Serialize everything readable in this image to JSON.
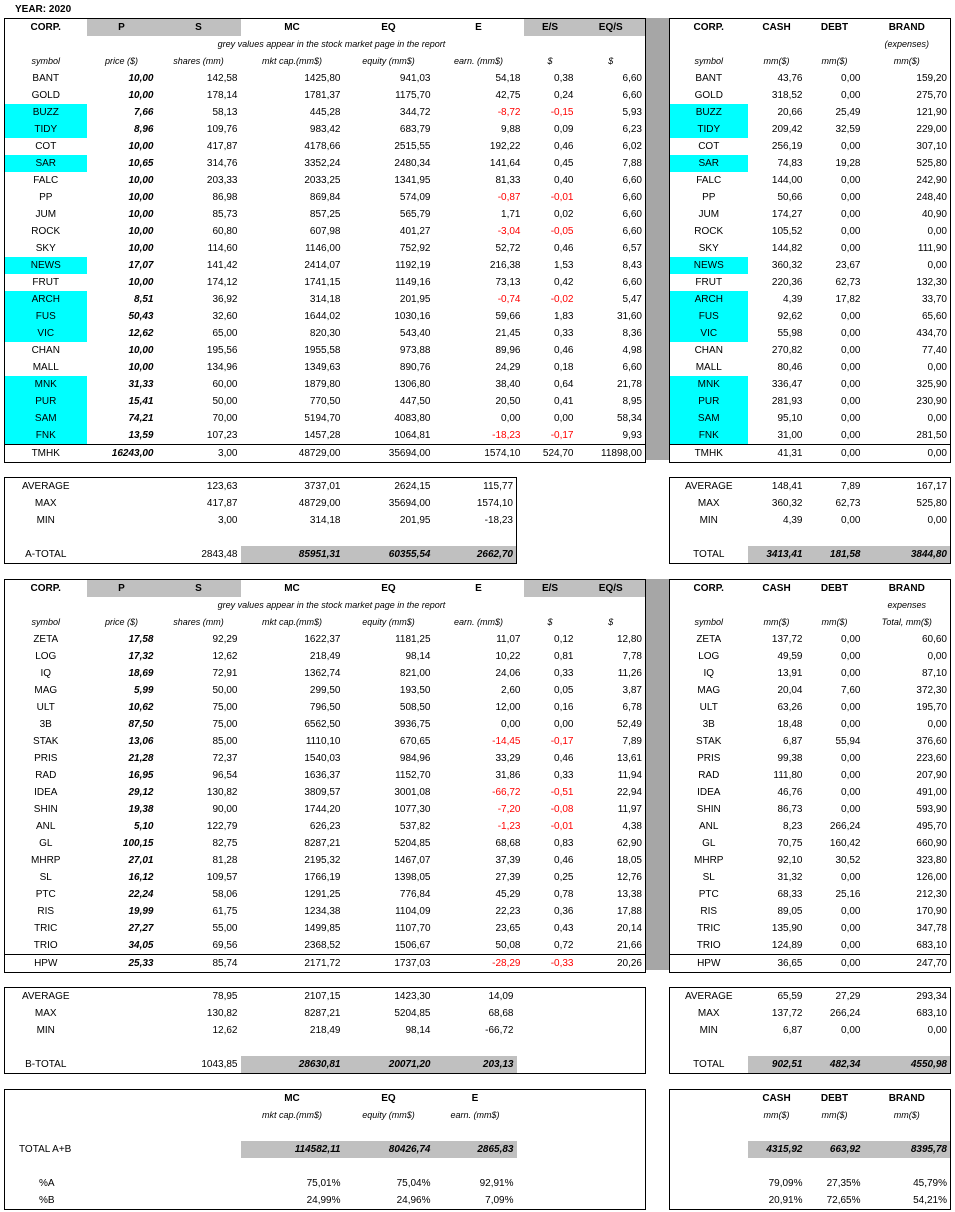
{
  "year": "YEAR: 2020",
  "colors": {
    "grey": "#c0c0c0",
    "cyan": "#00ffff",
    "negative": "#ff0000"
  },
  "left_headers": [
    "CORP.",
    "P",
    "S",
    "MC",
    "EQ",
    "E",
    "E/S",
    "EQ/S"
  ],
  "left_sub_note": "grey values appear in the stock market page in the report",
  "left_units": [
    "symbol",
    "price ($)",
    "shares (mm)",
    "mkt cap.(mm$)",
    "equity (mm$)",
    "earn. (mm$)",
    "$",
    "$"
  ],
  "right_headers_a": [
    "CORP.",
    "CASH",
    "DEBT",
    "BRAND"
  ],
  "right_note_a": "(expenses)",
  "right_units_a": [
    "symbol",
    "mm($)",
    "mm($)",
    "mm($)"
  ],
  "right_headers_b": [
    "CORP.",
    "CASH",
    "DEBT",
    "BRAND"
  ],
  "right_note_b": "expenses",
  "right_units_b": [
    "symbol",
    "mm($)",
    "mm($)",
    "Total, mm($)"
  ],
  "groupA": [
    {
      "sym": "BANT",
      "p": "10,00",
      "s": "142,58",
      "mc": "1425,80",
      "eq": "941,03",
      "e": "54,18",
      "es": "0,38",
      "eqs": "6,60",
      "cash": "43,76",
      "debt": "0,00",
      "brand": "159,20",
      "hl": false,
      "neg": false
    },
    {
      "sym": "GOLD",
      "p": "10,00",
      "s": "178,14",
      "mc": "1781,37",
      "eq": "1175,70",
      "e": "42,75",
      "es": "0,24",
      "eqs": "6,60",
      "cash": "318,52",
      "debt": "0,00",
      "brand": "275,70",
      "hl": false,
      "neg": false
    },
    {
      "sym": "BUZZ",
      "p": "7,66",
      "s": "58,13",
      "mc": "445,28",
      "eq": "344,72",
      "e": "-8,72",
      "es": "-0,15",
      "eqs": "5,93",
      "cash": "20,66",
      "debt": "25,49",
      "brand": "121,90",
      "hl": true,
      "neg": true
    },
    {
      "sym": "TIDY",
      "p": "8,96",
      "s": "109,76",
      "mc": "983,42",
      "eq": "683,79",
      "e": "9,88",
      "es": "0,09",
      "eqs": "6,23",
      "cash": "209,42",
      "debt": "32,59",
      "brand": "229,00",
      "hl": true,
      "neg": false
    },
    {
      "sym": "COT",
      "p": "10,00",
      "s": "417,87",
      "mc": "4178,66",
      "eq": "2515,55",
      "e": "192,22",
      "es": "0,46",
      "eqs": "6,02",
      "cash": "256,19",
      "debt": "0,00",
      "brand": "307,10",
      "hl": false,
      "neg": false
    },
    {
      "sym": "SAR",
      "p": "10,65",
      "s": "314,76",
      "mc": "3352,24",
      "eq": "2480,34",
      "e": "141,64",
      "es": "0,45",
      "eqs": "7,88",
      "cash": "74,83",
      "debt": "19,28",
      "brand": "525,80",
      "hl": true,
      "neg": false
    },
    {
      "sym": "FALC",
      "p": "10,00",
      "s": "203,33",
      "mc": "2033,25",
      "eq": "1341,95",
      "e": "81,33",
      "es": "0,40",
      "eqs": "6,60",
      "cash": "144,00",
      "debt": "0,00",
      "brand": "242,90",
      "hl": false,
      "neg": false
    },
    {
      "sym": "PP",
      "p": "10,00",
      "s": "86,98",
      "mc": "869,84",
      "eq": "574,09",
      "e": "-0,87",
      "es": "-0,01",
      "eqs": "6,60",
      "cash": "50,66",
      "debt": "0,00",
      "brand": "248,40",
      "hl": false,
      "neg": true
    },
    {
      "sym": "JUM",
      "p": "10,00",
      "s": "85,73",
      "mc": "857,25",
      "eq": "565,79",
      "e": "1,71",
      "es": "0,02",
      "eqs": "6,60",
      "cash": "174,27",
      "debt": "0,00",
      "brand": "40,90",
      "hl": false,
      "neg": false
    },
    {
      "sym": "ROCK",
      "p": "10,00",
      "s": "60,80",
      "mc": "607,98",
      "eq": "401,27",
      "e": "-3,04",
      "es": "-0,05",
      "eqs": "6,60",
      "cash": "105,52",
      "debt": "0,00",
      "brand": "0,00",
      "hl": false,
      "neg": true
    },
    {
      "sym": "SKY",
      "p": "10,00",
      "s": "114,60",
      "mc": "1146,00",
      "eq": "752,92",
      "e": "52,72",
      "es": "0,46",
      "eqs": "6,57",
      "cash": "144,82",
      "debt": "0,00",
      "brand": "111,90",
      "hl": false,
      "neg": false
    },
    {
      "sym": "NEWS",
      "p": "17,07",
      "s": "141,42",
      "mc": "2414,07",
      "eq": "1192,19",
      "e": "216,38",
      "es": "1,53",
      "eqs": "8,43",
      "cash": "360,32",
      "debt": "23,67",
      "brand": "0,00",
      "hl": true,
      "neg": false
    },
    {
      "sym": "FRUT",
      "p": "10,00",
      "s": "174,12",
      "mc": "1741,15",
      "eq": "1149,16",
      "e": "73,13",
      "es": "0,42",
      "eqs": "6,60",
      "cash": "220,36",
      "debt": "62,73",
      "brand": "132,30",
      "hl": false,
      "neg": false
    },
    {
      "sym": "ARCH",
      "p": "8,51",
      "s": "36,92",
      "mc": "314,18",
      "eq": "201,95",
      "e": "-0,74",
      "es": "-0,02",
      "eqs": "5,47",
      "cash": "4,39",
      "debt": "17,82",
      "brand": "33,70",
      "hl": true,
      "neg": true
    },
    {
      "sym": "FUS",
      "p": "50,43",
      "s": "32,60",
      "mc": "1644,02",
      "eq": "1030,16",
      "e": "59,66",
      "es": "1,83",
      "eqs": "31,60",
      "cash": "92,62",
      "debt": "0,00",
      "brand": "65,60",
      "hl": true,
      "neg": false
    },
    {
      "sym": "VIC",
      "p": "12,62",
      "s": "65,00",
      "mc": "820,30",
      "eq": "543,40",
      "e": "21,45",
      "es": "0,33",
      "eqs": "8,36",
      "cash": "55,98",
      "debt": "0,00",
      "brand": "434,70",
      "hl": true,
      "neg": false
    },
    {
      "sym": "CHAN",
      "p": "10,00",
      "s": "195,56",
      "mc": "1955,58",
      "eq": "973,88",
      "e": "89,96",
      "es": "0,46",
      "eqs": "4,98",
      "cash": "270,82",
      "debt": "0,00",
      "brand": "77,40",
      "hl": false,
      "neg": false
    },
    {
      "sym": "MALL",
      "p": "10,00",
      "s": "134,96",
      "mc": "1349,63",
      "eq": "890,76",
      "e": "24,29",
      "es": "0,18",
      "eqs": "6,60",
      "cash": "80,46",
      "debt": "0,00",
      "brand": "0,00",
      "hl": false,
      "neg": false
    },
    {
      "sym": "MNK",
      "p": "31,33",
      "s": "60,00",
      "mc": "1879,80",
      "eq": "1306,80",
      "e": "38,40",
      "es": "0,64",
      "eqs": "21,78",
      "cash": "336,47",
      "debt": "0,00",
      "brand": "325,90",
      "hl": true,
      "neg": false
    },
    {
      "sym": "PUR",
      "p": "15,41",
      "s": "50,00",
      "mc": "770,50",
      "eq": "447,50",
      "e": "20,50",
      "es": "0,41",
      "eqs": "8,95",
      "cash": "281,93",
      "debt": "0,00",
      "brand": "230,90",
      "hl": true,
      "neg": false
    },
    {
      "sym": "SAM",
      "p": "74,21",
      "s": "70,00",
      "mc": "5194,70",
      "eq": "4083,80",
      "e": "0,00",
      "es": "0,00",
      "eqs": "58,34",
      "cash": "95,10",
      "debt": "0,00",
      "brand": "0,00",
      "hl": true,
      "neg": false
    },
    {
      "sym": "FNK",
      "p": "13,59",
      "s": "107,23",
      "mc": "1457,28",
      "eq": "1064,81",
      "e": "-18,23",
      "es": "-0,17",
      "eqs": "9,93",
      "cash": "31,00",
      "debt": "0,00",
      "brand": "281,50",
      "hl": true,
      "neg": true
    },
    {
      "sym": "TMHK",
      "p": "16243,00",
      "s": "3,00",
      "mc": "48729,00",
      "eq": "35694,00",
      "e": "1574,10",
      "es": "524,70",
      "eqs": "11898,00",
      "cash": "41,31",
      "debt": "0,00",
      "brand": "0,00",
      "hl": false,
      "neg": false
    }
  ],
  "statsA": {
    "labels": [
      "AVERAGE",
      "MAX",
      "MIN"
    ],
    "s": [
      "123,63",
      "417,87",
      "3,00"
    ],
    "mc": [
      "3737,01",
      "48729,00",
      "314,18"
    ],
    "eq": [
      "2624,15",
      "35694,00",
      "201,95"
    ],
    "e": [
      "115,77",
      "1574,10",
      "-18,23"
    ],
    "cash": [
      "148,41",
      "360,32",
      "4,39"
    ],
    "debt": [
      "7,89",
      "62,73",
      "0,00"
    ],
    "brand": [
      "167,17",
      "525,80",
      "0,00"
    ]
  },
  "totalA": {
    "label": "A-TOTAL",
    "s": "2843,48",
    "mc": "85951,31",
    "eq": "60355,54",
    "e": "2662,70",
    "rlabel": "TOTAL",
    "cash": "3413,41",
    "debt": "181,58",
    "brand": "3844,80"
  },
  "groupB": [
    {
      "sym": "ZETA",
      "p": "17,58",
      "s": "92,29",
      "mc": "1622,37",
      "eq": "1181,25",
      "e": "11,07",
      "es": "0,12",
      "eqs": "12,80",
      "cash": "137,72",
      "debt": "0,00",
      "brand": "60,60",
      "neg": false
    },
    {
      "sym": "LOG",
      "p": "17,32",
      "s": "12,62",
      "mc": "218,49",
      "eq": "98,14",
      "e": "10,22",
      "es": "0,81",
      "eqs": "7,78",
      "cash": "49,59",
      "debt": "0,00",
      "brand": "0,00",
      "neg": false
    },
    {
      "sym": "IQ",
      "p": "18,69",
      "s": "72,91",
      "mc": "1362,74",
      "eq": "821,00",
      "e": "24,06",
      "es": "0,33",
      "eqs": "11,26",
      "cash": "13,91",
      "debt": "0,00",
      "brand": "87,10",
      "neg": false
    },
    {
      "sym": "MAG",
      "p": "5,99",
      "s": "50,00",
      "mc": "299,50",
      "eq": "193,50",
      "e": "2,60",
      "es": "0,05",
      "eqs": "3,87",
      "cash": "20,04",
      "debt": "7,60",
      "brand": "372,30",
      "neg": false
    },
    {
      "sym": "ULT",
      "p": "10,62",
      "s": "75,00",
      "mc": "796,50",
      "eq": "508,50",
      "e": "12,00",
      "es": "0,16",
      "eqs": "6,78",
      "cash": "63,26",
      "debt": "0,00",
      "brand": "195,70",
      "neg": false
    },
    {
      "sym": "3B",
      "p": "87,50",
      "s": "75,00",
      "mc": "6562,50",
      "eq": "3936,75",
      "e": "0,00",
      "es": "0,00",
      "eqs": "52,49",
      "cash": "18,48",
      "debt": "0,00",
      "brand": "0,00",
      "neg": false
    },
    {
      "sym": "STAK",
      "p": "13,06",
      "s": "85,00",
      "mc": "1110,10",
      "eq": "670,65",
      "e": "-14,45",
      "es": "-0,17",
      "eqs": "7,89",
      "cash": "6,87",
      "debt": "55,94",
      "brand": "376,60",
      "neg": true
    },
    {
      "sym": "PRIS",
      "p": "21,28",
      "s": "72,37",
      "mc": "1540,03",
      "eq": "984,96",
      "e": "33,29",
      "es": "0,46",
      "eqs": "13,61",
      "cash": "99,38",
      "debt": "0,00",
      "brand": "223,60",
      "neg": false
    },
    {
      "sym": "RAD",
      "p": "16,95",
      "s": "96,54",
      "mc": "1636,37",
      "eq": "1152,70",
      "e": "31,86",
      "es": "0,33",
      "eqs": "11,94",
      "cash": "111,80",
      "debt": "0,00",
      "brand": "207,90",
      "neg": false
    },
    {
      "sym": "IDEA",
      "p": "29,12",
      "s": "130,82",
      "mc": "3809,57",
      "eq": "3001,08",
      "e": "-66,72",
      "es": "-0,51",
      "eqs": "22,94",
      "cash": "46,76",
      "debt": "0,00",
      "brand": "491,00",
      "neg": true
    },
    {
      "sym": "SHIN",
      "p": "19,38",
      "s": "90,00",
      "mc": "1744,20",
      "eq": "1077,30",
      "e": "-7,20",
      "es": "-0,08",
      "eqs": "11,97",
      "cash": "86,73",
      "debt": "0,00",
      "brand": "593,90",
      "neg": true
    },
    {
      "sym": "ANL",
      "p": "5,10",
      "s": "122,79",
      "mc": "626,23",
      "eq": "537,82",
      "e": "-1,23",
      "es": "-0,01",
      "eqs": "4,38",
      "cash": "8,23",
      "debt": "266,24",
      "brand": "495,70",
      "neg": true
    },
    {
      "sym": "GL",
      "p": "100,15",
      "s": "82,75",
      "mc": "8287,21",
      "eq": "5204,85",
      "e": "68,68",
      "es": "0,83",
      "eqs": "62,90",
      "cash": "70,75",
      "debt": "160,42",
      "brand": "660,90",
      "neg": false
    },
    {
      "sym": "MHRP",
      "p": "27,01",
      "s": "81,28",
      "mc": "2195,32",
      "eq": "1467,07",
      "e": "37,39",
      "es": "0,46",
      "eqs": "18,05",
      "cash": "92,10",
      "debt": "30,52",
      "brand": "323,80",
      "neg": false
    },
    {
      "sym": "SL",
      "p": "16,12",
      "s": "109,57",
      "mc": "1766,19",
      "eq": "1398,05",
      "e": "27,39",
      "es": "0,25",
      "eqs": "12,76",
      "cash": "31,32",
      "debt": "0,00",
      "brand": "126,00",
      "neg": false
    },
    {
      "sym": "PTC",
      "p": "22,24",
      "s": "58,06",
      "mc": "1291,25",
      "eq": "776,84",
      "e": "45,29",
      "es": "0,78",
      "eqs": "13,38",
      "cash": "68,33",
      "debt": "25,16",
      "brand": "212,30",
      "neg": false
    },
    {
      "sym": "RIS",
      "p": "19,99",
      "s": "61,75",
      "mc": "1234,38",
      "eq": "1104,09",
      "e": "22,23",
      "es": "0,36",
      "eqs": "17,88",
      "cash": "89,05",
      "debt": "0,00",
      "brand": "170,90",
      "neg": false
    },
    {
      "sym": "TRIC",
      "p": "27,27",
      "s": "55,00",
      "mc": "1499,85",
      "eq": "1107,70",
      "e": "23,65",
      "es": "0,43",
      "eqs": "20,14",
      "cash": "135,90",
      "debt": "0,00",
      "brand": "347,78",
      "neg": false
    },
    {
      "sym": "TRIO",
      "p": "34,05",
      "s": "69,56",
      "mc": "2368,52",
      "eq": "1506,67",
      "e": "50,08",
      "es": "0,72",
      "eqs": "21,66",
      "cash": "124,89",
      "debt": "0,00",
      "brand": "683,10",
      "neg": false
    },
    {
      "sym": "HPW",
      "p": "25,33",
      "s": "85,74",
      "mc": "2171,72",
      "eq": "1737,03",
      "e": "-28,29",
      "es": "-0,33",
      "eqs": "20,26",
      "cash": "36,65",
      "debt": "0,00",
      "brand": "247,70",
      "neg": true
    }
  ],
  "statsB": {
    "labels": [
      "AVERAGE",
      "MAX",
      "MIN"
    ],
    "s": [
      "78,95",
      "130,82",
      "12,62"
    ],
    "mc": [
      "2107,15",
      "8287,21",
      "218,49"
    ],
    "eq": [
      "1423,30",
      "5204,85",
      "98,14"
    ],
    "e": [
      "14,09",
      "68,68",
      "-66,72"
    ],
    "cash": [
      "65,59",
      "137,72",
      "6,87"
    ],
    "debt": [
      "27,29",
      "266,24",
      "0,00"
    ],
    "brand": [
      "293,34",
      "683,10",
      "0,00"
    ]
  },
  "totalB": {
    "label": "B-TOTAL",
    "s": "1043,85",
    "mc": "28630,81",
    "eq": "20071,20",
    "e": "203,13",
    "rlabel": "TOTAL",
    "cash": "902,51",
    "debt": "482,34",
    "brand": "4550,98"
  },
  "summary": {
    "headers": [
      "MC",
      "EQ",
      "E"
    ],
    "units": [
      "mkt cap.(mm$)",
      "equity (mm$)",
      "earn. (mm$)"
    ],
    "r_headers": [
      "CASH",
      "DEBT",
      "BRAND"
    ],
    "r_units": [
      "mm($)",
      "mm($)",
      "mm($)"
    ],
    "total_label": "TOTAL A+B",
    "total": [
      "114582,11",
      "80426,74",
      "2865,83"
    ],
    "r_total": [
      "4315,92",
      "663,92",
      "8395,78"
    ],
    "pa_label": "%A",
    "pa": [
      "75,01%",
      "75,04%",
      "92,91%"
    ],
    "r_pa": [
      "79,09%",
      "27,35%",
      "45,79%"
    ],
    "pb_label": "%B",
    "pb": [
      "24,99%",
      "24,96%",
      "7,09%"
    ],
    "r_pb": [
      "20,91%",
      "72,65%",
      "54,21%"
    ]
  }
}
